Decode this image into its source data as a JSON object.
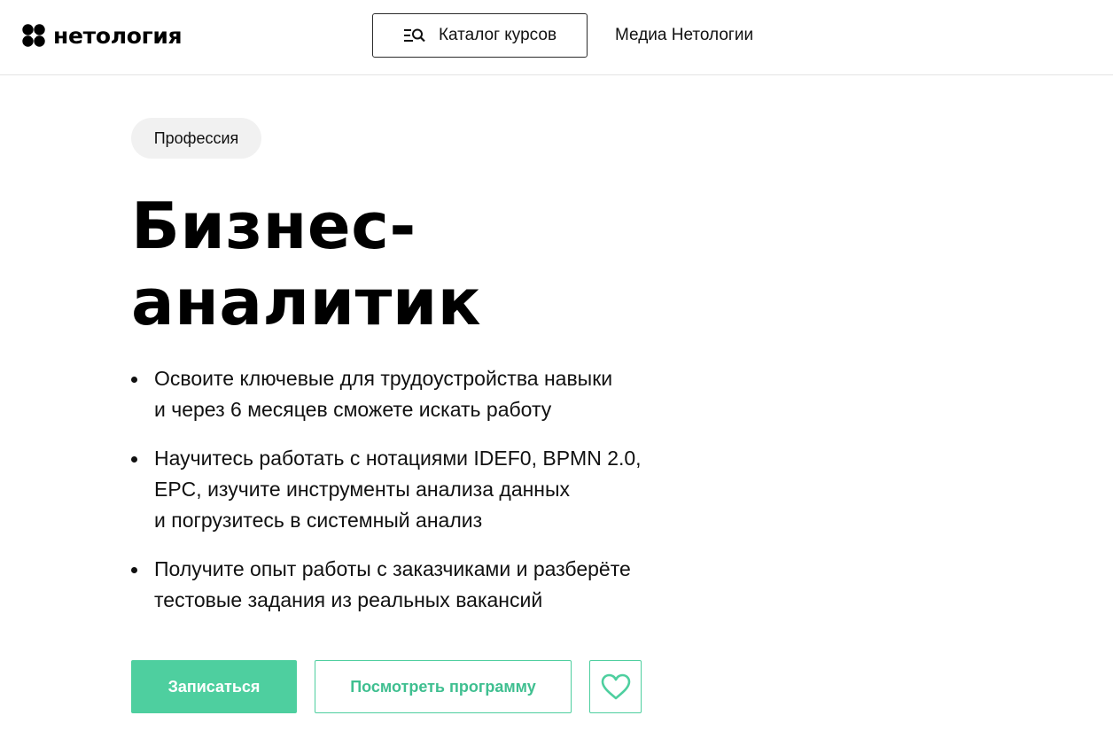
{
  "header": {
    "logo_text": "нетология",
    "catalog_label": "Каталог курсов",
    "media_label": "Медиа Нетологии"
  },
  "hero": {
    "badge": "Профессия",
    "title_lines": [
      "Бизнес-",
      "аналитик"
    ],
    "bullets": [
      [
        "Освоите ключевые для трудоустройства навыки",
        "и через 6 месяцев сможете искать работу"
      ],
      [
        "Научитесь работать с нотациями IDEF0, BPMN 2.0,",
        "EPC, изучите инструменты анализа данных",
        "и погрузитесь в системный анализ"
      ],
      [
        "Получите опыт работы с заказчиками и разберёте",
        "тестовые задания из реальных вакансий"
      ]
    ]
  },
  "actions": {
    "enroll_label": "Записаться",
    "program_label": "Посмотреть программу",
    "favorite_icon": "heart-icon"
  },
  "colors": {
    "accent": "#4ecf9f",
    "text": "#111111",
    "badge_bg": "#f1f1f1"
  },
  "icons": {
    "logo": "netology-logo-icon",
    "catalog": "search-list-icon"
  }
}
